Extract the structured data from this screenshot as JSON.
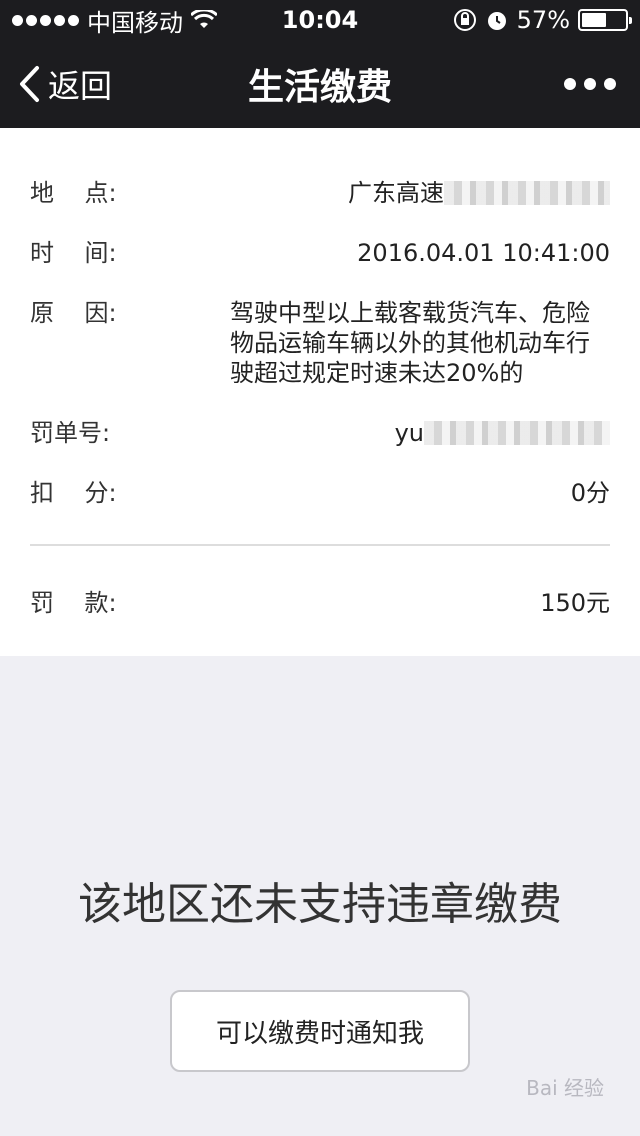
{
  "status_bar": {
    "carrier": "中国移动",
    "time": "10:04",
    "battery_percent": "57%",
    "battery_level": 0.57,
    "icons": [
      "signal-dots",
      "wifi-icon",
      "rotation-lock-icon",
      "alarm-icon",
      "battery-icon"
    ]
  },
  "nav": {
    "back_label": "返回",
    "title": "生活缴费"
  },
  "details": {
    "location_label": "地    点:",
    "location_value": "广东高速",
    "time_label": "时    间:",
    "time_value": "2016.04.01 10:41:00",
    "reason_label": "原    因:",
    "reason_value": "驾驶中型以上载客载货汽车、危险物品运输车辆以外的其他机动车行驶超过规定时速未达20%的",
    "ticket_label": "罚单号:",
    "ticket_value": "yu",
    "points_label": "扣    分:",
    "points_value": "0分",
    "fine_label": "罚    款:",
    "fine_value": "150元"
  },
  "notice": {
    "message": "该地区还未支持违章缴费",
    "button_label": "可以缴费时通知我"
  },
  "watermark": {
    "text": "Bai 经验"
  }
}
